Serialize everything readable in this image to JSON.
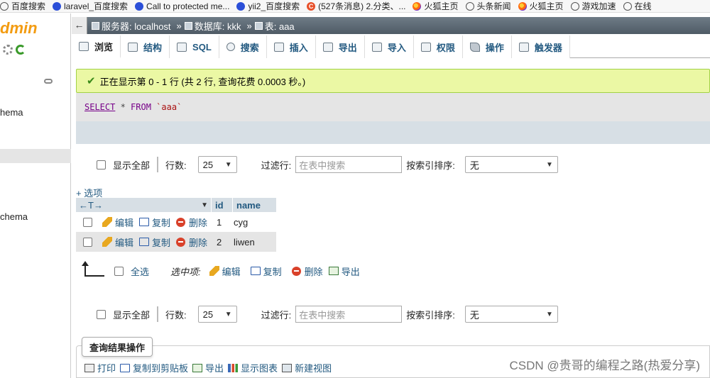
{
  "bookmarks": [
    {
      "label": "百度搜索",
      "icon": "globe-icon"
    },
    {
      "label": "laravel_百度搜索",
      "icon": "paw-icon"
    },
    {
      "label": "Call to protected me...",
      "icon": "paw-icon"
    },
    {
      "label": "yii2_百度搜索",
      "icon": "paw-icon"
    },
    {
      "label": "(527条消息) 2.分类、...",
      "icon": "csdn-icon"
    },
    {
      "label": "火狐主页",
      "icon": "firefox-icon"
    },
    {
      "label": "头条新闻",
      "icon": "globe-icon"
    },
    {
      "label": "火狐主页",
      "icon": "firefox-icon"
    },
    {
      "label": "游戏加速",
      "icon": "globe-icon"
    },
    {
      "label": "在线",
      "icon": "globe-icon"
    }
  ],
  "sidebar": {
    "logo": "dmin",
    "db1": "hema",
    "db2": "chema"
  },
  "breadcrumb": {
    "back": "←",
    "server": "服务器: localhost",
    "database": "数据库: kkk",
    "table": "表: aaa",
    "sep": "»"
  },
  "tabs": [
    {
      "label": "浏览",
      "icon": "browse-icon"
    },
    {
      "label": "结构",
      "icon": "structure-icon"
    },
    {
      "label": "SQL",
      "icon": "sql-icon"
    },
    {
      "label": "搜索",
      "icon": "search-icon"
    },
    {
      "label": "插入",
      "icon": "insert-icon"
    },
    {
      "label": "导出",
      "icon": "export-icon"
    },
    {
      "label": "导入",
      "icon": "import-icon"
    },
    {
      "label": "权限",
      "icon": "privileges-icon"
    },
    {
      "label": "操作",
      "icon": "wrench-icon"
    },
    {
      "label": "触发器",
      "icon": "triggers-icon"
    }
  ],
  "success_message": "正在显示第 0 - 1 行 (共 2 行, 查询花费 0.0003 秒。)",
  "sql": {
    "select": "SELECT",
    "star": " * ",
    "from": "FROM",
    "table": " `aaa`"
  },
  "nav": {
    "show_all": "显示全部",
    "rows_label": "行数:",
    "rows_value": "25",
    "filter_label": "过滤行:",
    "filter_placeholder": "在表中搜索",
    "sort_label": "按索引排序:",
    "sort_value": "无"
  },
  "options_link": "+ 选项",
  "table": {
    "arrows": "←T→",
    "columns": [
      "id",
      "name"
    ],
    "row_actions": {
      "edit": "编辑",
      "copy": "复制",
      "delete": "删除"
    },
    "rows": [
      {
        "id": "1",
        "name": "cyg"
      },
      {
        "id": "2",
        "name": "liwen"
      }
    ]
  },
  "bulk": {
    "select_all": "全选",
    "with_selected": "选中项:",
    "edit": "编辑",
    "copy": "复制",
    "delete": "删除",
    "export": "导出"
  },
  "query_ops": {
    "title": "查询结果操作",
    "print": "打印",
    "copy_clipboard": "复制到剪贴板",
    "export": "导出",
    "chart": "显示图表",
    "create_view": "新建视图"
  },
  "watermark": "CSDN @贵哥的编程之路(热爱分享)"
}
